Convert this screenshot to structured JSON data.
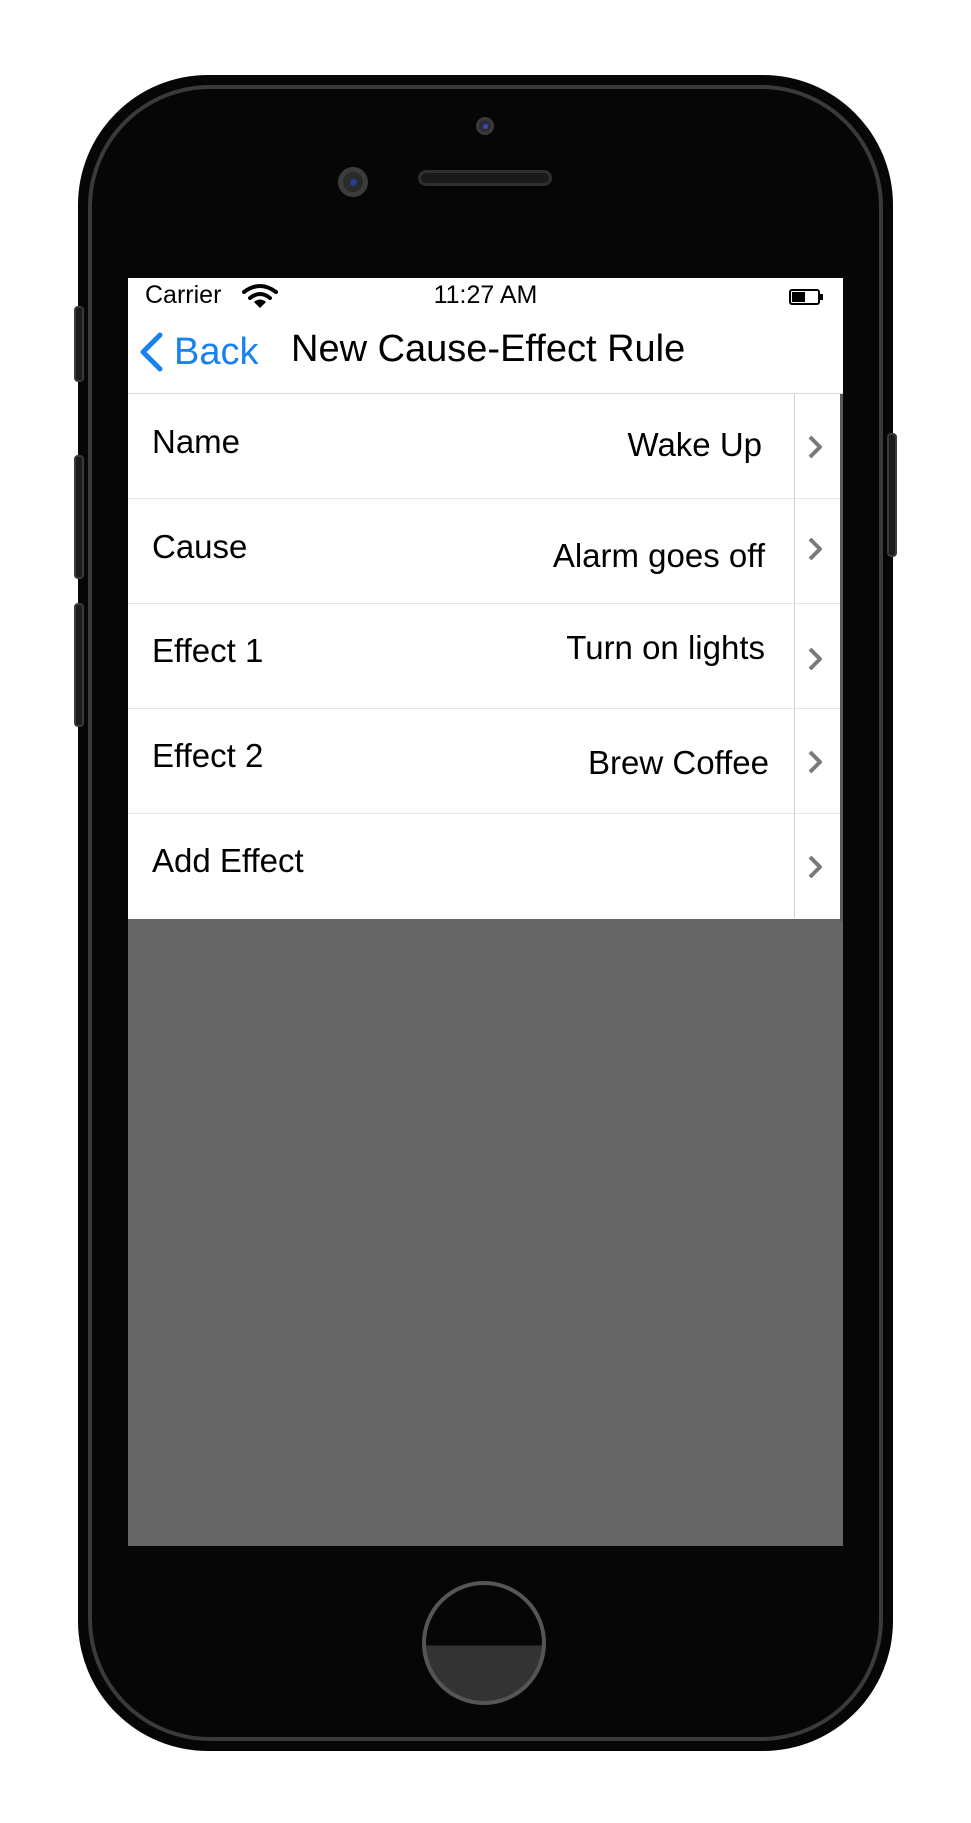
{
  "status_bar": {
    "carrier": "Carrier",
    "time": "11:27 AM",
    "wifi_icon": "wifi-icon",
    "battery_icon": "battery-icon"
  },
  "nav": {
    "back_label": "Back",
    "title": "New Cause-Effect Rule",
    "accent_color": "#1a82f0"
  },
  "rows": [
    {
      "label": "Name",
      "value": "Wake Up"
    },
    {
      "label": "Cause",
      "value": "Alarm goes off"
    },
    {
      "label": "Effect 1",
      "value": "Turn on lights"
    },
    {
      "label": "Effect 2",
      "value": "Brew Coffee"
    },
    {
      "label": "Add Effect",
      "value": ""
    }
  ],
  "colors": {
    "screen_background": "#646564",
    "device_body": "#060606"
  }
}
